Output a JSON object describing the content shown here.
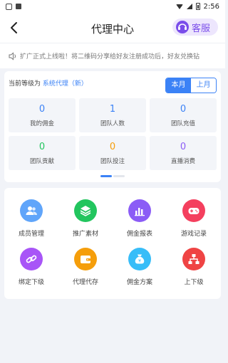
{
  "status_bar": {
    "time": "2:56"
  },
  "header": {
    "title": "代理中心",
    "service_label": "客服"
  },
  "notice": {
    "text": "扩广正式上线啦！将二维码分享给好友注册成功后，好友兑换钻"
  },
  "level": {
    "prefix": "当前等级为",
    "value": "系统代理（新）"
  },
  "period_tabs": {
    "current": "本月",
    "previous": "上月"
  },
  "stats": [
    {
      "value": "0",
      "label": "我的佣金",
      "color": "#3b82f6"
    },
    {
      "value": "1",
      "label": "团队人数",
      "color": "#3b82f6"
    },
    {
      "value": "0",
      "label": "团队充值",
      "color": "#3b82f6"
    },
    {
      "value": "0",
      "label": "团队贡献",
      "color": "#22c55e"
    },
    {
      "value": "0",
      "label": "团队投注",
      "color": "#f59e0b"
    },
    {
      "value": "0",
      "label": "直播消费",
      "color": "#8b5cf6"
    }
  ],
  "menu": [
    {
      "label": "成员管理",
      "icon": "members-icon",
      "color": "#60a5fa"
    },
    {
      "label": "推广素材",
      "icon": "layers-icon",
      "color": "#22c55e"
    },
    {
      "label": "佣金报表",
      "icon": "bar-chart-icon",
      "color": "#8b5cf6"
    },
    {
      "label": "游戏记录",
      "icon": "gamepad-icon",
      "color": "#f43f5e"
    },
    {
      "label": "绑定下级",
      "icon": "link-icon",
      "color": "#a855f7"
    },
    {
      "label": "代理代存",
      "icon": "wallet-icon",
      "color": "#f59e0b"
    },
    {
      "label": "佣金方案",
      "icon": "money-bag-icon",
      "color": "#38bdf8"
    },
    {
      "label": "上下级",
      "icon": "hierarchy-icon",
      "color": "#ef4444"
    }
  ]
}
